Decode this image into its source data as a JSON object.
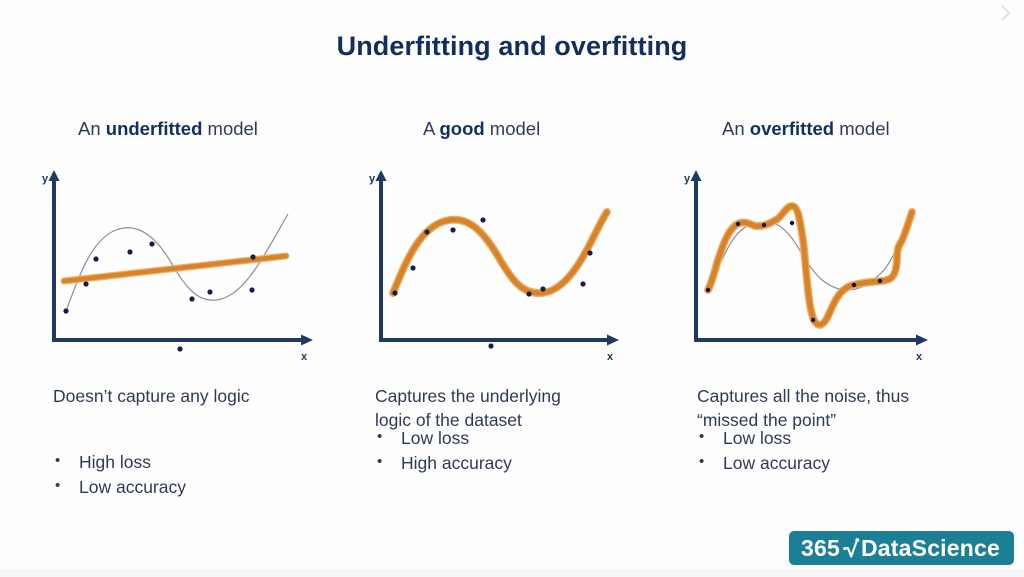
{
  "slide": {
    "title": "Underfitting and overfitting",
    "corner_icon": "chevron-right-icon",
    "background_color": "#fefefe",
    "title_color": "#132d5e",
    "text_color": "#2f3a56"
  },
  "logo": {
    "prefix": "365",
    "mark": "radical-icon",
    "name": "DataScience",
    "background_color": "#1b7f96",
    "text_color": "#ffffff"
  },
  "panels": [
    {
      "heading_prefix": "An ",
      "heading_bold": "underfitted",
      "heading_suffix": " model",
      "caption": "Doesn’t capture any logic",
      "bullets": [
        "High loss",
        "Low accuracy"
      ]
    },
    {
      "heading_prefix": "A ",
      "heading_bold": "good",
      "heading_suffix": " model",
      "caption": "Captures the underlying\nlogic of the dataset",
      "bullets": [
        "Low loss",
        "High accuracy"
      ]
    },
    {
      "heading_prefix": "An ",
      "heading_bold": "overfitted",
      "heading_suffix": " model",
      "caption": "Captures all the noise, thus\n“missed the point”",
      "bullets": [
        "Low loss",
        "Low accuracy"
      ]
    }
  ],
  "chart_data": [
    {
      "type": "scatter",
      "title": "An underfitted model",
      "xlabel": "x",
      "ylabel": "y",
      "axis_color": "#1f3864",
      "grid": false,
      "xlim": [
        0,
        300
      ],
      "ylim": [
        0,
        200
      ],
      "points": [
        {
          "x": 46,
          "y": 60
        },
        {
          "x": 66,
          "y": 88
        },
        {
          "x": 76,
          "y": 114
        },
        {
          "x": 110,
          "y": 122
        },
        {
          "x": 132,
          "y": 130
        },
        {
          "x": 172,
          "y": 72
        },
        {
          "x": 190,
          "y": 80
        },
        {
          "x": 232,
          "y": 82
        },
        {
          "x": 233,
          "y": 115
        },
        {
          "x": 160,
          "y": 22
        }
      ],
      "series": [
        {
          "name": "true-function",
          "style": "thin-gray-curve",
          "color": "#8c8c99",
          "description": "underlying sine-like curve rising then dipping then rising"
        },
        {
          "name": "fitted-model",
          "style": "thick-orange-line",
          "color": "#d8822a",
          "description": "nearly flat straight line with slight positive slope, badly underfitting"
        }
      ]
    },
    {
      "type": "scatter",
      "title": "A good model",
      "xlabel": "x",
      "ylabel": "y",
      "axis_color": "#1f3864",
      "grid": false,
      "xlim": [
        0,
        300
      ],
      "ylim": [
        0,
        200
      ],
      "points": [
        {
          "x": 46,
          "y": 58
        },
        {
          "x": 68,
          "y": 92
        },
        {
          "x": 84,
          "y": 126
        },
        {
          "x": 116,
          "y": 128
        },
        {
          "x": 146,
          "y": 136
        },
        {
          "x": 180,
          "y": 86
        },
        {
          "x": 192,
          "y": 90
        },
        {
          "x": 234,
          "y": 96
        },
        {
          "x": 240,
          "y": 126
        },
        {
          "x": 152,
          "y": 24
        }
      ],
      "series": [
        {
          "name": "true-function",
          "style": "thin-gray-curve",
          "color": "#8c8c99",
          "description": "underlying smooth curve"
        },
        {
          "name": "fitted-model",
          "style": "thick-orange-curve",
          "color": "#d8822a",
          "description": "smooth curve closely tracking the underlying function"
        }
      ]
    },
    {
      "type": "scatter",
      "title": "An overfitted model",
      "xlabel": "x",
      "ylabel": "y",
      "axis_color": "#1f3864",
      "grid": false,
      "xlim": [
        0,
        300
      ],
      "ylim": [
        0,
        200
      ],
      "points": [
        {
          "x": 42,
          "y": 58
        },
        {
          "x": 76,
          "y": 122
        },
        {
          "x": 112,
          "y": 130
        },
        {
          "x": 142,
          "y": 128
        },
        {
          "x": 160,
          "y": 30
        },
        {
          "x": 208,
          "y": 88
        },
        {
          "x": 232,
          "y": 92
        }
      ],
      "series": [
        {
          "name": "true-function",
          "style": "thin-gray-curve",
          "color": "#8c8c99",
          "description": "underlying smooth curve"
        },
        {
          "name": "fitted-model",
          "style": "thick-orange-wiggly-curve",
          "color": "#d8822a",
          "description": "highly wiggly curve passing exactly through every noisy point with sharp spikes"
        }
      ]
    }
  ]
}
